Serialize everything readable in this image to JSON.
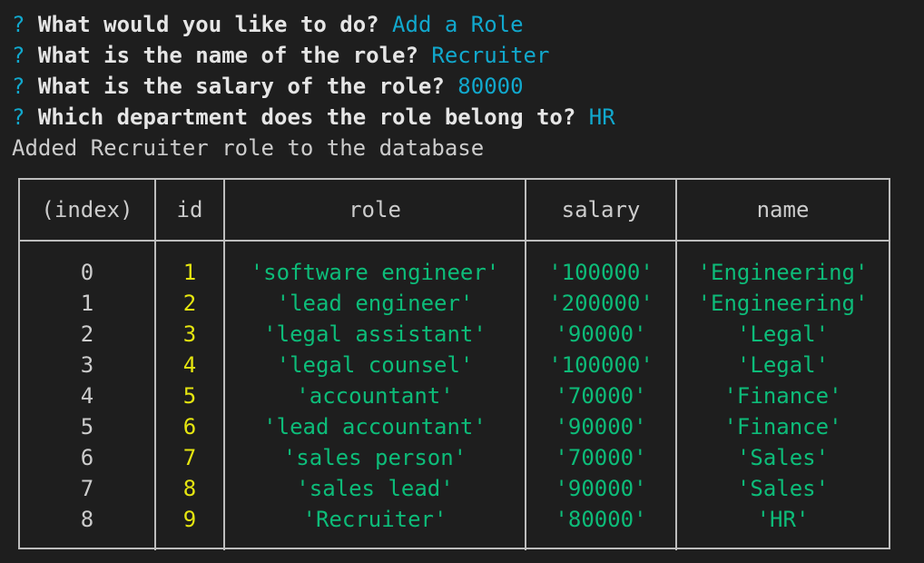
{
  "prompts": [
    {
      "mark": "?",
      "question": "What would you like to do?",
      "answer": "Add a Role"
    },
    {
      "mark": "?",
      "question": "What is the name of the role?",
      "answer": "Recruiter"
    },
    {
      "mark": "?",
      "question": "What is the salary of the role?",
      "answer": "80000"
    },
    {
      "mark": "?",
      "question": "Which department does the role belong to?",
      "answer": "HR"
    }
  ],
  "message": "Added Recruiter role to the database",
  "table": {
    "headers": [
      "(index)",
      "id",
      "role",
      "salary",
      "name"
    ],
    "rows": [
      [
        "0",
        "1",
        "'software engineer'",
        "'100000'",
        "'Engineering'"
      ],
      [
        "1",
        "2",
        "'lead engineer'",
        "'200000'",
        "'Engineering'"
      ],
      [
        "2",
        "3",
        "'legal assistant'",
        "'90000'",
        "'Legal'"
      ],
      [
        "3",
        "4",
        "'legal counsel'",
        "'100000'",
        "'Legal'"
      ],
      [
        "4",
        "5",
        "'accountant'",
        "'70000'",
        "'Finance'"
      ],
      [
        "5",
        "6",
        "'lead accountant'",
        "'90000'",
        "'Finance'"
      ],
      [
        "6",
        "7",
        "'sales person'",
        "'70000'",
        "'Sales'"
      ],
      [
        "7",
        "8",
        "'sales lead'",
        "'90000'",
        "'Sales'"
      ],
      [
        "8",
        "9",
        "'Recruiter'",
        "'80000'",
        "'HR'"
      ]
    ]
  },
  "colors": {
    "background": "#1e1e1e",
    "prompt_mark": "#11a8cd",
    "answer": "#11a8cd",
    "question": "#e5e5e5",
    "id_number": "#e5e510",
    "string_value": "#0dbc79",
    "border": "#bdbdbd"
  }
}
